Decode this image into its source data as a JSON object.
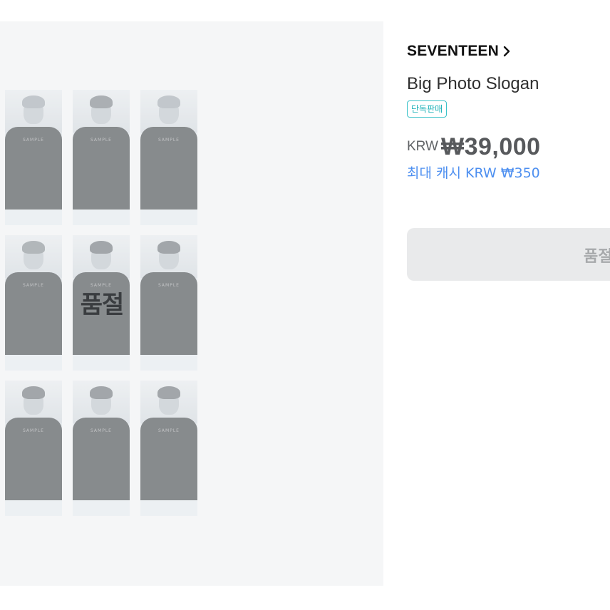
{
  "gallery": {
    "watermark_text": "SAMPLE",
    "soldout_overlay": "품절"
  },
  "product": {
    "artist": "SEVENTEEN",
    "title": "Big Photo Slogan",
    "badge": "단독판매",
    "currency": "KRW",
    "price": "₩39,000",
    "cash_reward": "최대 캐시 KRW ₩350",
    "button_label": "품절"
  },
  "colors": {
    "accent_blue": "#4d8ff0",
    "badge_teal": "#1fb2b9",
    "panel_bg": "#f5f6f7",
    "button_bg": "#e9eaeb"
  },
  "icons": {
    "artist_link": "chevron-right-icon"
  }
}
